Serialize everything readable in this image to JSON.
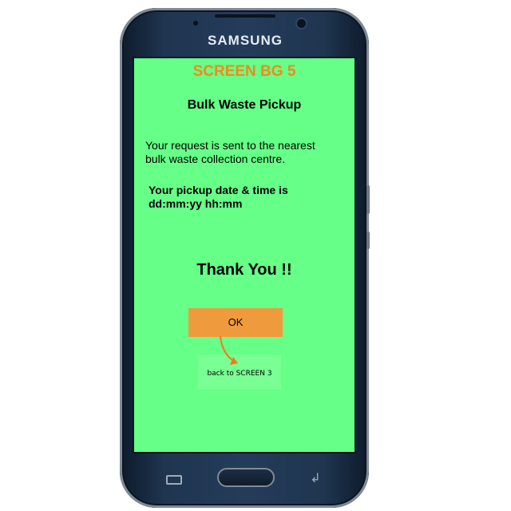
{
  "device": {
    "brand": "SAMSUNG"
  },
  "screen": {
    "screen_title": "SCREEN BG 5",
    "page_heading": "Bulk Waste Pickup",
    "message": "Your request is sent to the nearest bulk waste collection centre.",
    "pickup_line1": "Your pickup date & time is",
    "pickup_line2": "dd:mm:yy hh:mm",
    "thanks": "Thank You !!",
    "ok_button": "OK",
    "annotation": "back to SCREEN 3"
  },
  "colors": {
    "screen_bg": "#66ff88",
    "title": "#f08a1c",
    "button": "#f09a3e",
    "phone_body": "#1f3550"
  },
  "icons": {
    "menu": "recent-apps-icon",
    "back": "back-arrow-icon",
    "annotation_arrow": "curved-arrow-icon"
  }
}
